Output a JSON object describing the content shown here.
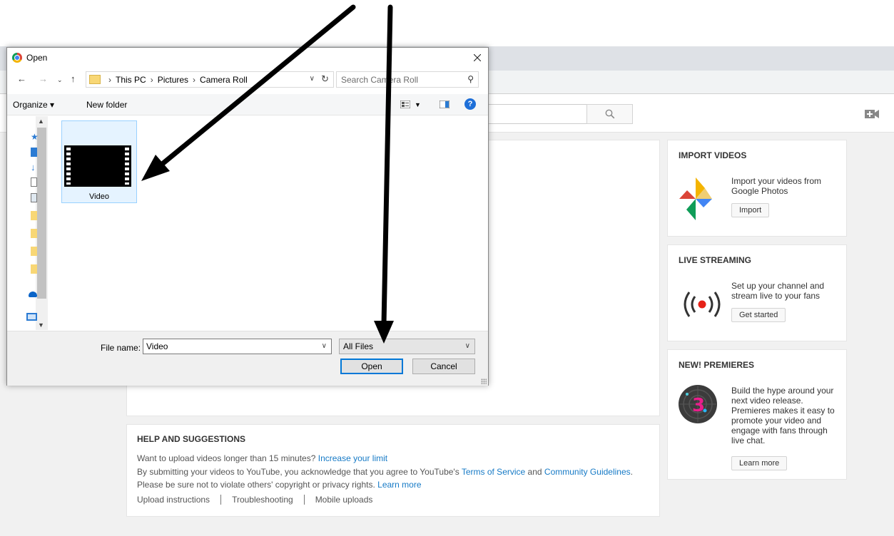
{
  "youtube": {
    "import_videos": {
      "title": "IMPORT VIDEOS",
      "text": "Import your videos from Google Photos",
      "button": "Import"
    },
    "live_streaming": {
      "title": "LIVE STREAMING",
      "text": "Set up your channel and stream live to your fans",
      "button": "Get started"
    },
    "premieres": {
      "title": "NEW! PREMIERES",
      "text": "Build the hype around your next video release. Premieres makes it easy to promote your video and engage with fans through live chat.",
      "button": "Learn more"
    },
    "help": {
      "title": "HELP AND SUGGESTIONS",
      "line1_text": "Want to upload videos longer than 15 minutes?",
      "line1_link": "Increase your limit",
      "line2_prefix": "By submitting your videos to YouTube, you acknowledge that you agree to YouTube's",
      "line2_link1": "Terms of Service",
      "line2_and": "and",
      "line2_link2": "Community Guidelines",
      "line2_suffix": ".",
      "line3_text": "Please be sure not to violate others' copyright or privacy rights.",
      "line3_link": "Learn more",
      "links": [
        "Upload instructions",
        "Troubleshooting",
        "Mobile uploads"
      ]
    }
  },
  "dialog": {
    "title": "Open",
    "breadcrumb": [
      "This PC",
      "Pictures",
      "Camera Roll"
    ],
    "search_placeholder": "Search Camera Roll",
    "organize_label": "Organize ▾",
    "new_folder_label": "New folder",
    "help_glyph": "?",
    "file": {
      "name": "Video"
    },
    "file_name_label": "File name:",
    "file_name_value": "Video",
    "file_type_value": "All Files",
    "open_button": "Open",
    "cancel_button": "Cancel"
  },
  "colors": {
    "link": "#167ac6",
    "selection_bg": "#e5f3ff",
    "live_red": "#e62117"
  }
}
